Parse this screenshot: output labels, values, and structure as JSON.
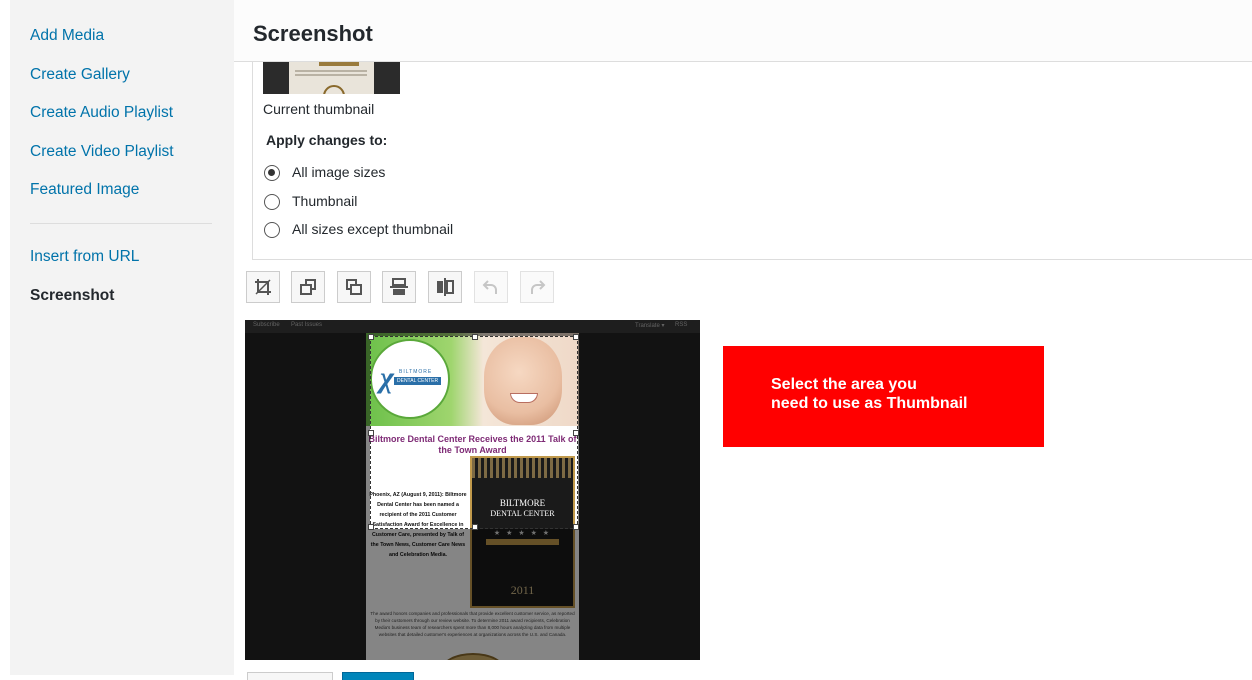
{
  "sidebar": {
    "items": [
      {
        "label": "Add Media"
      },
      {
        "label": "Create Gallery"
      },
      {
        "label": "Create Audio Playlist"
      },
      {
        "label": "Create Video Playlist"
      },
      {
        "label": "Featured Image"
      },
      {
        "label": "Insert from URL"
      },
      {
        "label": "Screenshot",
        "active": true
      }
    ]
  },
  "header": {
    "title": "Screenshot"
  },
  "thumbnail": {
    "caption": "Current thumbnail"
  },
  "apply_changes": {
    "label": "Apply changes to:",
    "options": [
      {
        "label": "All image sizes",
        "checked": true
      },
      {
        "label": "Thumbnail",
        "checked": false
      },
      {
        "label": "All sizes except thumbnail",
        "checked": false
      }
    ]
  },
  "toolbar": {
    "buttons": [
      {
        "icon": "crop-icon"
      },
      {
        "icon": "rotate-left-icon"
      },
      {
        "icon": "rotate-right-icon"
      },
      {
        "icon": "flip-vertical-icon"
      },
      {
        "icon": "flip-horizontal-icon"
      },
      {
        "icon": "undo-icon",
        "disabled": true
      },
      {
        "icon": "redo-icon",
        "disabled": true
      }
    ]
  },
  "editor_image": {
    "topbar": {
      "left1": "Subscribe",
      "left2": "Past Issues",
      "right1": "Translate ▾",
      "right2": "RSS"
    },
    "logo": {
      "line1": "BILTMORE",
      "line2": "DENTAL CENTER"
    },
    "headline": "Biltmore Dental Center Receives the 2011 Talk of the Town Award",
    "body": "Phoenix, AZ (August 9, 2011): Biltmore Dental Center has been named a recipient of the 2011 Customer Satisfaction Award for Excellence in Customer Care, presented by Talk of the Town News, Customer Care News and Celebration Media.",
    "award": {
      "line1": "BILTMORE",
      "line2": "DENTAL CENTER",
      "stars": "★ ★ ★ ★ ★",
      "year": "2011"
    },
    "footer": "The award honors companies and professionals that provide excellent customer service, as reported by their customers through our review website. To determine 2011 award recipients, Celebration Media's business team of researchers spent more than 8,000 hours analyzing data from multiple websites that detailed customer's experiences at organizations across the U.S. and Canada."
  },
  "callout": {
    "line1": "Select the area you",
    "line2": "need to use as Thumbnail",
    "color": "#ff0000"
  },
  "colors": {
    "link": "#0073aa",
    "text": "#23282d",
    "sidebar_bg": "#f3f3f3"
  }
}
